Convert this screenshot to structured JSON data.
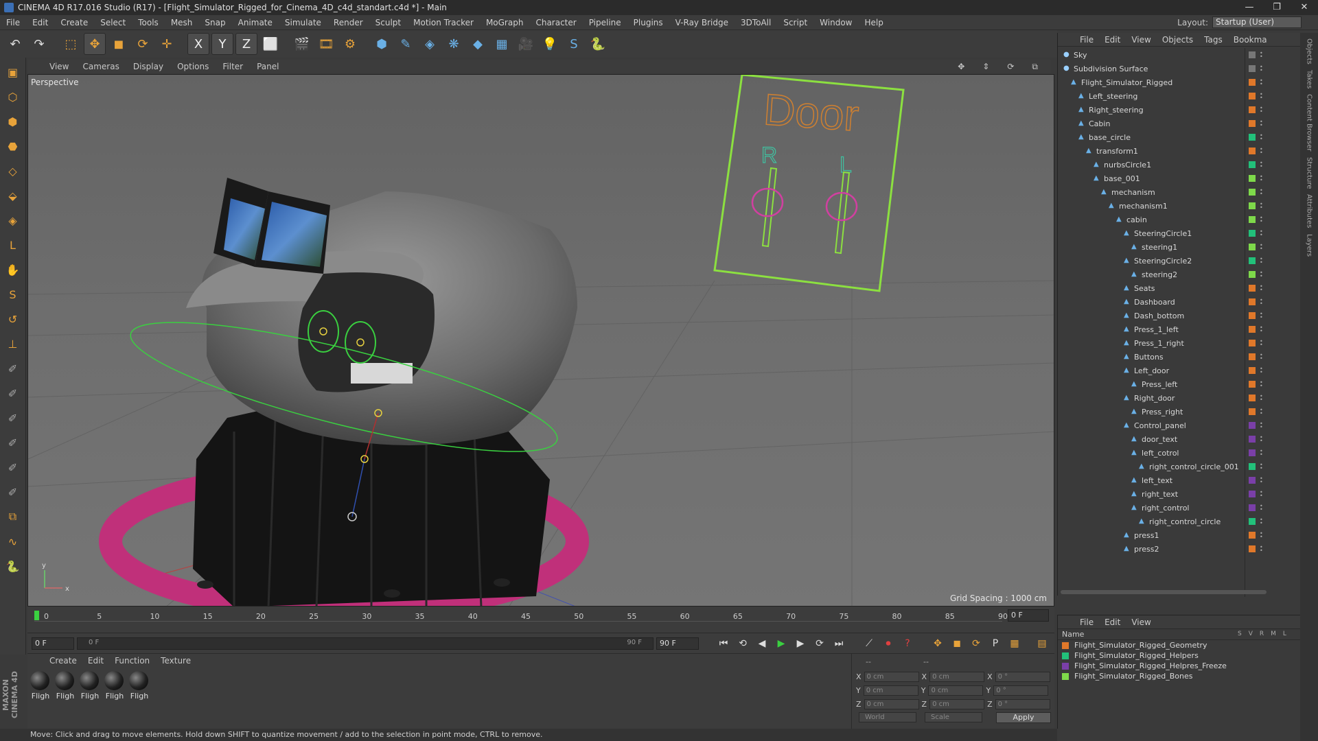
{
  "window": {
    "title": "CINEMA 4D R17.016 Studio (R17) - [Flight_Simulator_Rigged_for_Cinema_4D_c4d_standart.c4d *] - Main",
    "controls": [
      "—",
      "❐",
      "✕"
    ]
  },
  "menubar": {
    "items": [
      "File",
      "Edit",
      "Create",
      "Select",
      "Tools",
      "Mesh",
      "Snap",
      "Animate",
      "Simulate",
      "Render",
      "Sculpt",
      "Motion Tracker",
      "MoGraph",
      "Character",
      "Pipeline",
      "Plugins",
      "V-Ray Bridge",
      "3DToAll",
      "Script",
      "Window",
      "Help"
    ],
    "layout_label": "Layout:",
    "layout_value": "Startup (User)"
  },
  "toolbar": {
    "icons": [
      "undo-icon",
      "redo-icon",
      "live-selection-icon",
      "move-icon",
      "scale-icon",
      "rotate-icon",
      "transform-icon",
      "x-axis-icon",
      "y-axis-icon",
      "z-axis-icon",
      "coordinate-system-icon",
      "render-view-icon",
      "render-picture-viewer-icon",
      "edit-render-settings-icon",
      "cube-icon",
      "pen-icon",
      "subdivision-icon",
      "array-icon",
      "deformer-icon",
      "floor-icon",
      "camera-icon",
      "light-icon",
      "vray-icon",
      "python-icon"
    ],
    "glyphs": [
      "↶",
      "↷",
      "⬚",
      "✥",
      "◼",
      "⟳",
      "✛",
      "X",
      "Y",
      "Z",
      "⬜",
      "🎬",
      "🎞",
      "⚙",
      "⬢",
      "✎",
      "◈",
      "❋",
      "◆",
      "▦",
      "🎥",
      "💡",
      "S",
      "🐍"
    ]
  },
  "left_tools": {
    "glyphs": [
      "▣",
      "⬡",
      "⬢",
      "⬣",
      "◇",
      "⬙",
      "◈",
      "L",
      "✋",
      "S",
      "↺",
      "⊥",
      "✐",
      "✐",
      "✐",
      "✐",
      "✐",
      "✐",
      "⧉",
      "∿",
      "🐍"
    ]
  },
  "viewport": {
    "menu": [
      "View",
      "Cameras",
      "Display",
      "Options",
      "Filter",
      "Panel"
    ],
    "label": "Perspective",
    "grid_spacing": "Grid Spacing : 1000 cm",
    "door_text": "Door",
    "r_text": "R",
    "l_text": "L",
    "axis_y": "y",
    "axis_x": "x"
  },
  "timeline": {
    "ticks": [
      "0",
      "5",
      "10",
      "15",
      "20",
      "25",
      "30",
      "35",
      "40",
      "45",
      "50",
      "55",
      "60",
      "65",
      "70",
      "75",
      "80",
      "85",
      "90"
    ],
    "current_frame": "0 F"
  },
  "playbar": {
    "start": "0 F",
    "slider_start": "0 F",
    "slider_end": "90 F",
    "end": "90 F",
    "buttons": [
      "⏮",
      "⟲",
      "◀",
      "▶",
      "▶",
      "⟳",
      "⏭"
    ]
  },
  "material_panel": {
    "menu": [
      "Create",
      "Edit",
      "Function",
      "Texture"
    ],
    "materials": [
      "Fligh",
      "Fligh",
      "Fligh",
      "Fligh",
      "Fligh"
    ]
  },
  "coordinates": {
    "header": "--",
    "header2": "--",
    "rows": [
      {
        "a": "X",
        "av": "0 cm",
        "b": "X",
        "bv": "0 cm",
        "c": "X",
        "cv": "0 °"
      },
      {
        "a": "Y",
        "av": "0 cm",
        "b": "Y",
        "bv": "0 cm",
        "c": "Y",
        "cv": "0 °"
      },
      {
        "a": "Z",
        "av": "0 cm",
        "b": "Z",
        "bv": "0 cm",
        "c": "Z",
        "cv": "0 °"
      }
    ],
    "world": "World",
    "scale": "Scale",
    "apply": "Apply"
  },
  "status": "Move: Click and drag to move elements. Hold down SHIFT to quantize movement / add to the selection in point mode, CTRL to remove.",
  "maxon_logo": "MAXON CINEMA 4D",
  "object_manager": {
    "menu": [
      "File",
      "Edit",
      "View",
      "Objects",
      "Tags",
      "Bookma"
    ],
    "objects": [
      {
        "name": "Sky",
        "indent": 0,
        "color": "#777777"
      },
      {
        "name": "Subdivision Surface",
        "indent": 0,
        "color": "#777777"
      },
      {
        "name": "Flight_Simulator_Rigged",
        "indent": 1,
        "color": "#e0782a"
      },
      {
        "name": "Left_steering",
        "indent": 2,
        "color": "#e0782a"
      },
      {
        "name": "Right_steering",
        "indent": 2,
        "color": "#e0782a"
      },
      {
        "name": "Cabin",
        "indent": 2,
        "color": "#e0782a"
      },
      {
        "name": "base_circle",
        "indent": 2,
        "color": "#22c07a"
      },
      {
        "name": "transform1",
        "indent": 3,
        "color": "#e0782a"
      },
      {
        "name": "nurbsCircle1",
        "indent": 4,
        "color": "#22c07a"
      },
      {
        "name": "base_001",
        "indent": 4,
        "color": "#7ed94a"
      },
      {
        "name": "mechanism",
        "indent": 5,
        "color": "#7ed94a"
      },
      {
        "name": "mechanism1",
        "indent": 6,
        "color": "#7ed94a"
      },
      {
        "name": "cabin",
        "indent": 7,
        "color": "#7ed94a"
      },
      {
        "name": "SteeringCircle1",
        "indent": 8,
        "color": "#22c07a"
      },
      {
        "name": "steering1",
        "indent": 9,
        "color": "#7ed94a"
      },
      {
        "name": "SteeringCircle2",
        "indent": 8,
        "color": "#22c07a"
      },
      {
        "name": "steering2",
        "indent": 9,
        "color": "#7ed94a"
      },
      {
        "name": "Seats",
        "indent": 8,
        "color": "#e0782a"
      },
      {
        "name": "Dashboard",
        "indent": 8,
        "color": "#e0782a"
      },
      {
        "name": "Dash_bottom",
        "indent": 8,
        "color": "#e0782a"
      },
      {
        "name": "Press_1_left",
        "indent": 8,
        "color": "#e0782a"
      },
      {
        "name": "Press_1_right",
        "indent": 8,
        "color": "#e0782a"
      },
      {
        "name": "Buttons",
        "indent": 8,
        "color": "#e0782a"
      },
      {
        "name": "Left_door",
        "indent": 8,
        "color": "#e0782a"
      },
      {
        "name": "Press_left",
        "indent": 9,
        "color": "#e0782a"
      },
      {
        "name": "Right_door",
        "indent": 8,
        "color": "#e0782a"
      },
      {
        "name": "Press_right",
        "indent": 9,
        "color": "#e0782a"
      },
      {
        "name": "Control_panel",
        "indent": 8,
        "color": "#7a3fa8"
      },
      {
        "name": "door_text",
        "indent": 9,
        "color": "#7a3fa8"
      },
      {
        "name": "left_cotrol",
        "indent": 9,
        "color": "#7a3fa8"
      },
      {
        "name": "right_control_circle_001",
        "indent": 10,
        "color": "#22c07a"
      },
      {
        "name": "left_text",
        "indent": 9,
        "color": "#7a3fa8"
      },
      {
        "name": "right_text",
        "indent": 9,
        "color": "#7a3fa8"
      },
      {
        "name": "right_control",
        "indent": 9,
        "color": "#7a3fa8"
      },
      {
        "name": "right_control_circle",
        "indent": 10,
        "color": "#22c07a"
      },
      {
        "name": "press1",
        "indent": 8,
        "color": "#e0782a"
      },
      {
        "name": "press2",
        "indent": 8,
        "color": "#e0782a"
      }
    ]
  },
  "layer_manager": {
    "menu": [
      "File",
      "Edit",
      "View"
    ],
    "name_header": "Name",
    "columns": [
      "S",
      "V",
      "R",
      "M",
      "L"
    ],
    "layers": [
      {
        "name": "Flight_Simulator_Rigged_Geometry",
        "color": "#e0782a"
      },
      {
        "name": "Flight_Simulator_Rigged_Helpers",
        "color": "#22c07a"
      },
      {
        "name": "Flight_Simulator_Rigged_Helpres_Freeze",
        "color": "#7a3fa8"
      },
      {
        "name": "Flight_Simulator_Rigged_Bones",
        "color": "#7ed94a"
      }
    ]
  },
  "right_tabs": [
    "Objects",
    "Takes",
    "Content Browser",
    "Structure",
    "Attributes",
    "Layers"
  ]
}
